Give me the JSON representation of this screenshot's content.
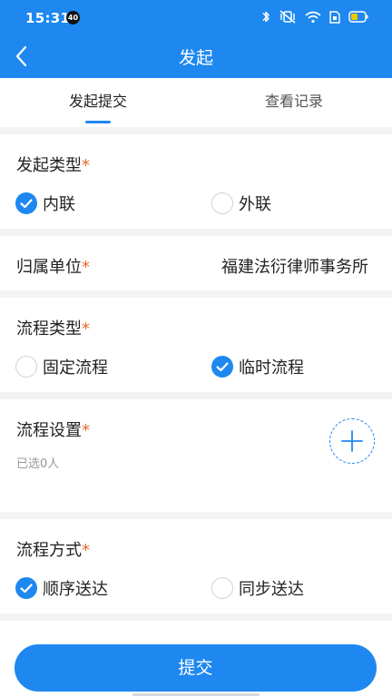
{
  "status_bar": {
    "time": "15:31",
    "notification_count": "40",
    "battery_color": "#f3c400"
  },
  "header": {
    "title": "发起"
  },
  "tabs": [
    {
      "label": "发起提交",
      "active": true
    },
    {
      "label": "查看记录",
      "active": false
    }
  ],
  "form": {
    "initiate_type": {
      "label": "发起类型",
      "required_mark": "*",
      "options": [
        {
          "label": "内联",
          "checked": true
        },
        {
          "label": "外联",
          "checked": false
        }
      ]
    },
    "unit": {
      "label": "归属单位",
      "required_mark": "*",
      "value": "福建法衍律师事务所"
    },
    "flow_type": {
      "label": "流程类型",
      "required_mark": "*",
      "options": [
        {
          "label": "固定流程",
          "checked": false
        },
        {
          "label": "临时流程",
          "checked": true
        }
      ]
    },
    "flow_setting": {
      "label": "流程设置",
      "required_mark": "*",
      "hint": "已选0人",
      "add_icon": "plus-icon"
    },
    "flow_mode": {
      "label": "流程方式",
      "required_mark": "*",
      "options": [
        {
          "label": "顺序送达",
          "checked": true
        },
        {
          "label": "同步送达",
          "checked": false
        }
      ]
    }
  },
  "submit": {
    "label": "提交"
  },
  "colors": {
    "accent": "#1e88f0",
    "required": "#e8672e",
    "page_background": "#f2f3f5"
  }
}
